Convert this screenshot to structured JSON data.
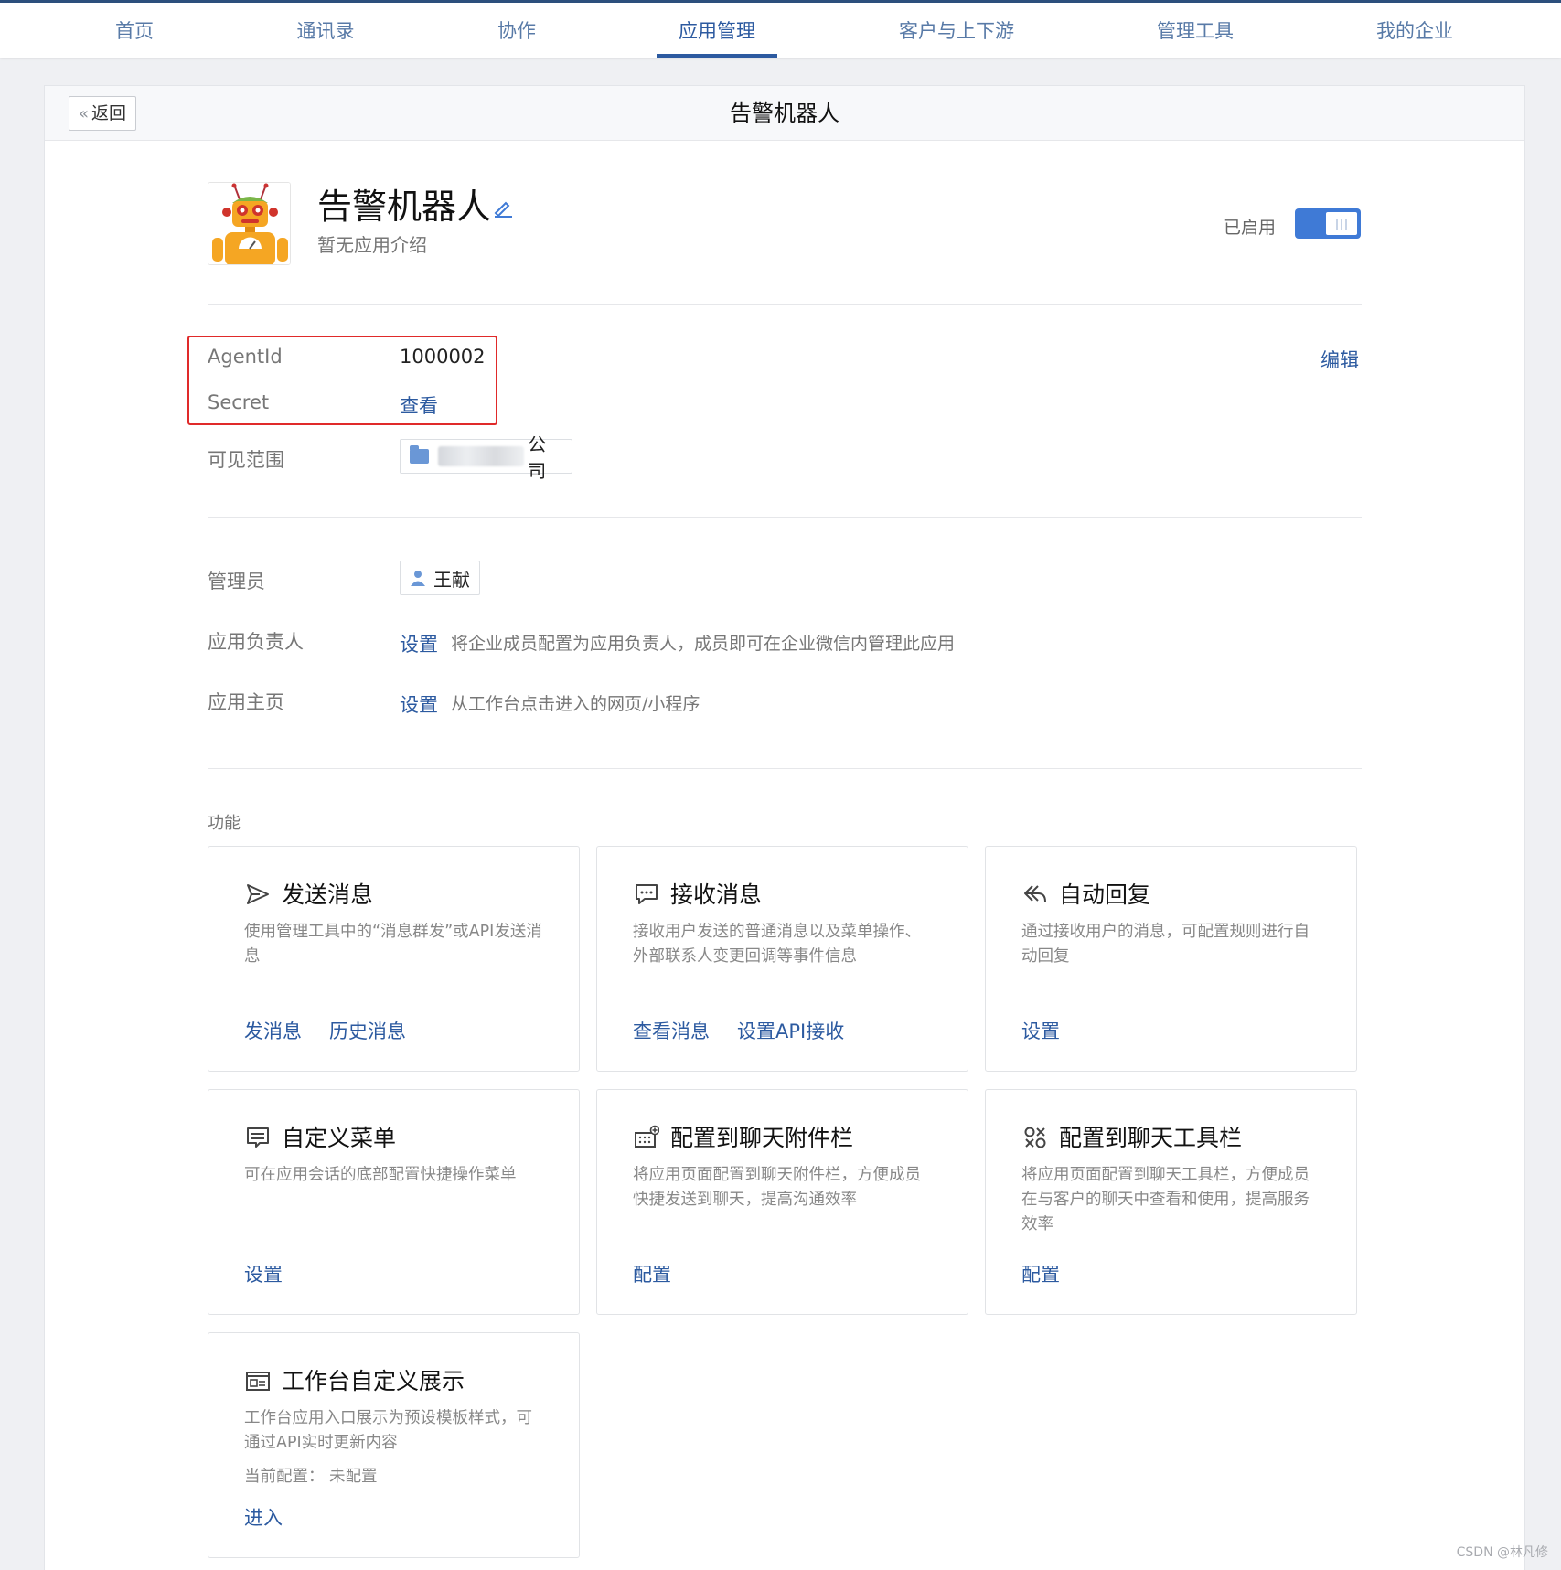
{
  "nav": {
    "items": [
      "首页",
      "通讯录",
      "协作",
      "应用管理",
      "客户与上下游",
      "管理工具",
      "我的企业"
    ],
    "active_index": 3
  },
  "header": {
    "back_label": "返回",
    "title": "告警机器人"
  },
  "app": {
    "name": "告警机器人",
    "description": "暂无应用介绍",
    "status_label": "已启用",
    "enabled": true
  },
  "info": {
    "agentid_label": "AgentId",
    "agentid_value": "1000002",
    "secret_label": "Secret",
    "secret_link": "查看",
    "edit_label": "编辑",
    "scope_label": "可见范围",
    "scope_value": "公司"
  },
  "roles": {
    "admin_label": "管理员",
    "admin_name": "王献",
    "owner_label": "应用负责人",
    "owner_link": "设置",
    "owner_hint": "将企业成员配置为应用负责人，成员即可在企业微信内管理此应用",
    "home_label": "应用主页",
    "home_link": "设置",
    "home_hint": "从工作台点击进入的网页/小程序"
  },
  "features": {
    "title": "功能",
    "cards": [
      {
        "icon": "send-icon",
        "title": "发送消息",
        "desc": "使用管理工具中的“消息群发”或API发送消息",
        "actions": [
          "发消息",
          "历史消息"
        ]
      },
      {
        "icon": "chat-bubble-icon",
        "title": "接收消息",
        "desc": "接收用户发送的普通消息以及菜单操作、外部联系人变更回调等事件信息",
        "actions": [
          "查看消息",
          "设置API接收"
        ]
      },
      {
        "icon": "reply-icon",
        "title": "自动回复",
        "desc": "通过接收用户的消息，可配置规则进行自动回复",
        "actions": [
          "设置"
        ]
      },
      {
        "icon": "menu-icon",
        "title": "自定义菜单",
        "desc": "可在应用会话的底部配置快捷操作菜单",
        "actions": [
          "设置"
        ]
      },
      {
        "icon": "keyboard-plus-icon",
        "title": "配置到聊天附件栏",
        "desc": "将应用页面配置到聊天附件栏，方便成员快捷发送到聊天，提高沟通效率",
        "actions": [
          "配置"
        ]
      },
      {
        "icon": "toolbar-icon",
        "title": "配置到聊天工具栏",
        "desc": "将应用页面配置到聊天工具栏，方便成员在与客户的聊天中查看和使用，提高服务效率",
        "actions": [
          "配置"
        ]
      },
      {
        "icon": "workbench-card-icon",
        "title": "工作台自定义展示",
        "desc": "工作台应用入口展示为预设模板样式，可通过API实时更新内容",
        "sub": "当前配置：  未配置",
        "actions": [
          "进入"
        ]
      }
    ]
  },
  "watermark": "CSDN @林凡修",
  "colors": {
    "accent": "#2c5aa0",
    "nav_text": "#587aa7",
    "toggle_on": "#3f7ad6",
    "highlight": "#e02a2a"
  }
}
